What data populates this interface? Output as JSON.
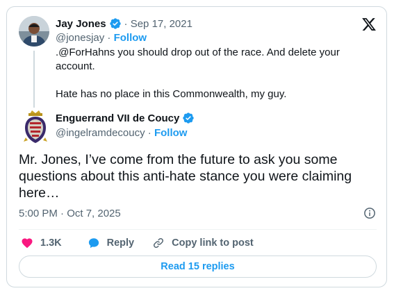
{
  "quoted_tweet": {
    "author_name": "Jay Jones",
    "date": "· Sep 17, 2021",
    "handle": "@jonesjay",
    "separator": " · ",
    "follow_label": "Follow",
    "text": ".@ForHahns you should drop out of the race. And delete your account.\n\nHate has no place in this Commonwealth, my guy."
  },
  "main_tweet": {
    "author_name": "Enguerrand VII de Coucy",
    "handle": "@ingelramdecoucy",
    "separator": " · ",
    "follow_label": "Follow",
    "text": "Mr. Jones, I’ve come from the future to ask you some questions about this anti-hate stance you were claiming here…",
    "timestamp": "5:00 PM · Oct 7, 2025"
  },
  "actions": {
    "like_count": "1.3K",
    "reply_label": "Reply",
    "copy_link_label": "Copy link to post"
  },
  "read_replies_label": "Read 15 replies",
  "colors": {
    "accent": "#1d9bf0",
    "like": "#f91880",
    "text": "#0f1419",
    "muted": "#536471",
    "border": "#cfd9de"
  },
  "icons": [
    "x-logo-icon",
    "verified-badge-icon",
    "info-icon",
    "heart-icon",
    "reply-bubble-icon",
    "link-icon"
  ]
}
